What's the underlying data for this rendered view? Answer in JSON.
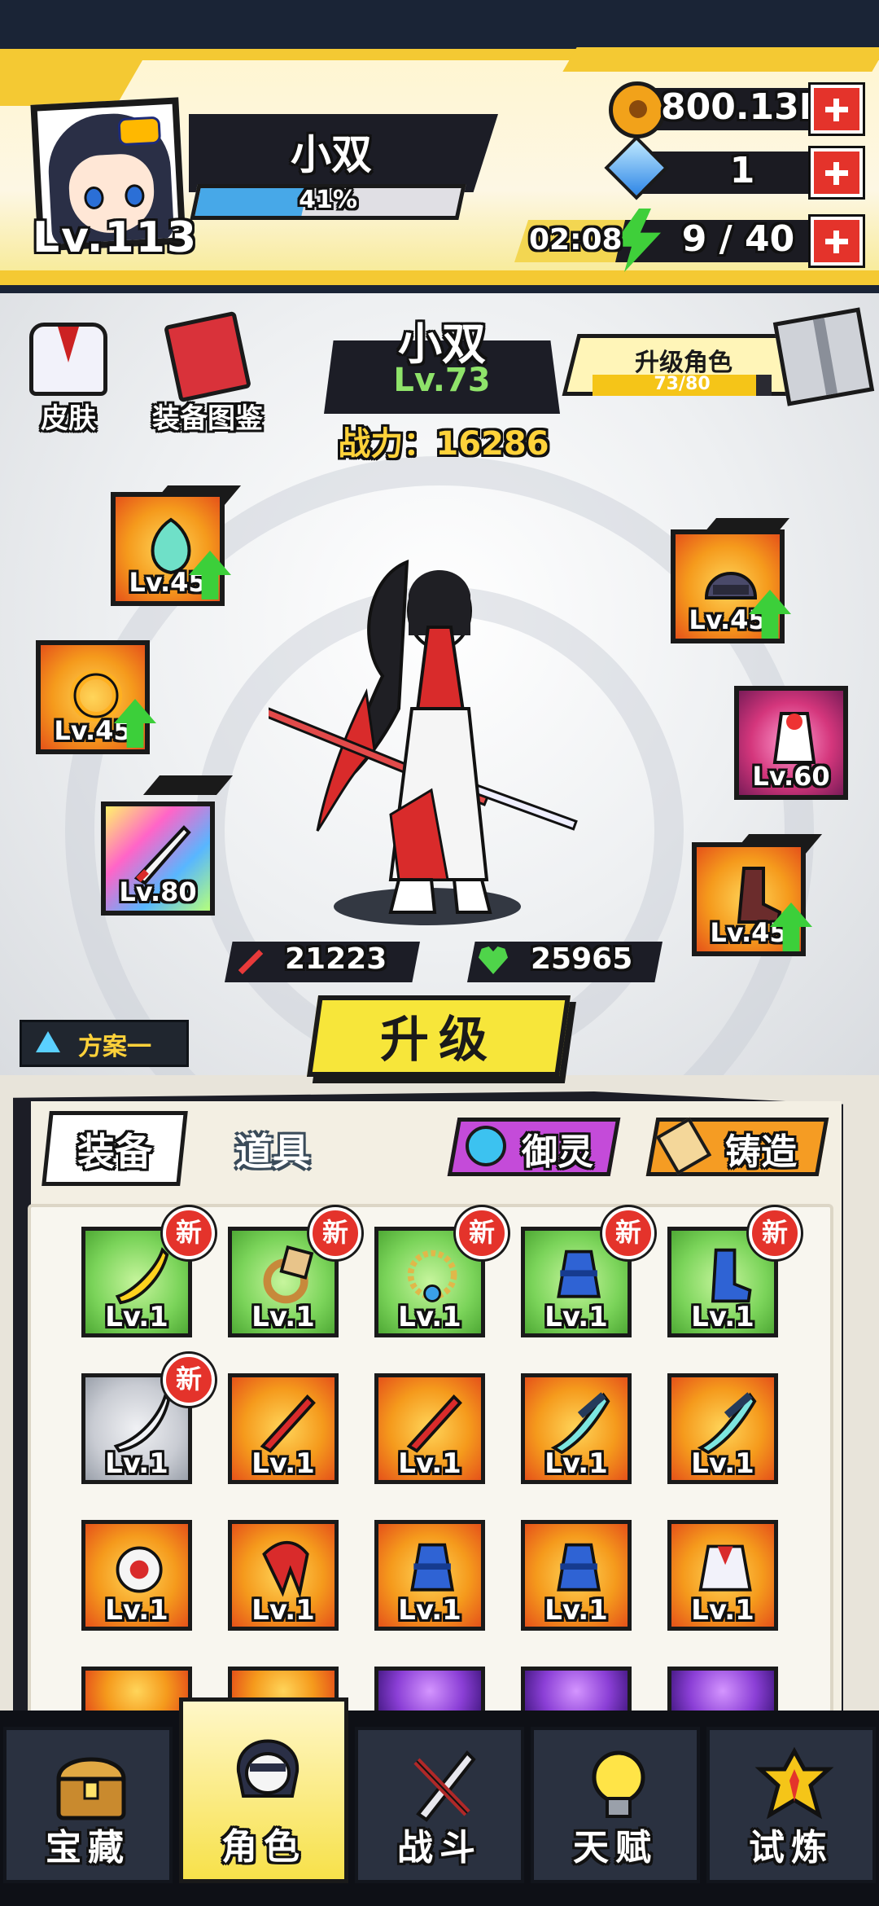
{
  "header": {
    "player_level": "Lv.113",
    "player_name": "小双",
    "exp_percent": "41%",
    "exp_fraction": 0.41,
    "gold": "800.13K",
    "gems": "1",
    "energy_timer": "02:08",
    "energy": "9 / 40"
  },
  "side_buttons": {
    "skin": "皮肤",
    "equip_codex": "装备图鉴"
  },
  "hero": {
    "name": "小双",
    "level": "Lv.73",
    "power": "战力：16286",
    "attack": "21223",
    "hp": "25965"
  },
  "upgrade_character": {
    "label": "升级角色",
    "progress": "73/80",
    "fraction": 0.9125
  },
  "equipped_slots": [
    {
      "name": "pendant",
      "level": "Lv.45",
      "upgradable": true
    },
    {
      "name": "ring",
      "level": "Lv.45",
      "upgradable": true
    },
    {
      "name": "weapon",
      "level": "Lv.80",
      "upgradable": false
    },
    {
      "name": "helmet",
      "level": "Lv.45",
      "upgradable": true
    },
    {
      "name": "armor",
      "level": "Lv.60",
      "upgradable": false
    },
    {
      "name": "boots",
      "level": "Lv.45",
      "upgradable": true
    }
  ],
  "plan_button": "方案一",
  "upgrade_button": "升级",
  "inventory": {
    "tabs": [
      "装备",
      "道具"
    ],
    "active_tab": "装备",
    "yuling_button": "御灵",
    "forge_button": "铸造",
    "new_badge": "新",
    "items": [
      {
        "rarity": "green",
        "art": "banana-blade",
        "level": "Lv.1",
        "new": true
      },
      {
        "rarity": "green",
        "art": "bronze-ring",
        "level": "Lv.1",
        "new": true
      },
      {
        "rarity": "green",
        "art": "bead-necklace",
        "level": "Lv.1",
        "new": true
      },
      {
        "rarity": "green",
        "art": "blue-robe",
        "level": "Lv.1",
        "new": true
      },
      {
        "rarity": "green",
        "art": "blue-boot",
        "level": "Lv.1",
        "new": true
      },
      {
        "rarity": "gray",
        "art": "steel-blade",
        "level": "Lv.1",
        "new": true
      },
      {
        "rarity": "orange",
        "art": "red-blade",
        "level": "Lv.1",
        "new": false
      },
      {
        "rarity": "orange",
        "art": "red-blade",
        "level": "Lv.1",
        "new": false
      },
      {
        "rarity": "orange",
        "art": "ice-blade",
        "level": "Lv.1",
        "new": false
      },
      {
        "rarity": "orange",
        "art": "ice-blade",
        "level": "Lv.1",
        "new": false
      },
      {
        "rarity": "orange",
        "art": "pearl-ring",
        "level": "Lv.1",
        "new": false
      },
      {
        "rarity": "orange",
        "art": "red-scarf",
        "level": "Lv.1",
        "new": false
      },
      {
        "rarity": "orange",
        "art": "blue-robe",
        "level": "Lv.1",
        "new": false
      },
      {
        "rarity": "orange",
        "art": "blue-robe",
        "level": "Lv.1",
        "new": false
      },
      {
        "rarity": "orange",
        "art": "sailor-top",
        "level": "Lv.1",
        "new": false
      }
    ]
  },
  "bottom_nav": [
    {
      "label": "宝藏",
      "icon": "treasure-chest-icon",
      "active": false
    },
    {
      "label": "角色",
      "icon": "character-icon",
      "active": true
    },
    {
      "label": "战斗",
      "icon": "battle-icon",
      "active": false
    },
    {
      "label": "天赋",
      "icon": "lightbulb-icon",
      "active": false
    },
    {
      "label": "试炼",
      "icon": "trial-emblem-icon",
      "active": false
    }
  ],
  "colors": {
    "accent_yellow": "#f7e63a",
    "badge_red": "#e4332b",
    "level_green": "#8fe36a",
    "power_gold": "#ffd23a"
  }
}
